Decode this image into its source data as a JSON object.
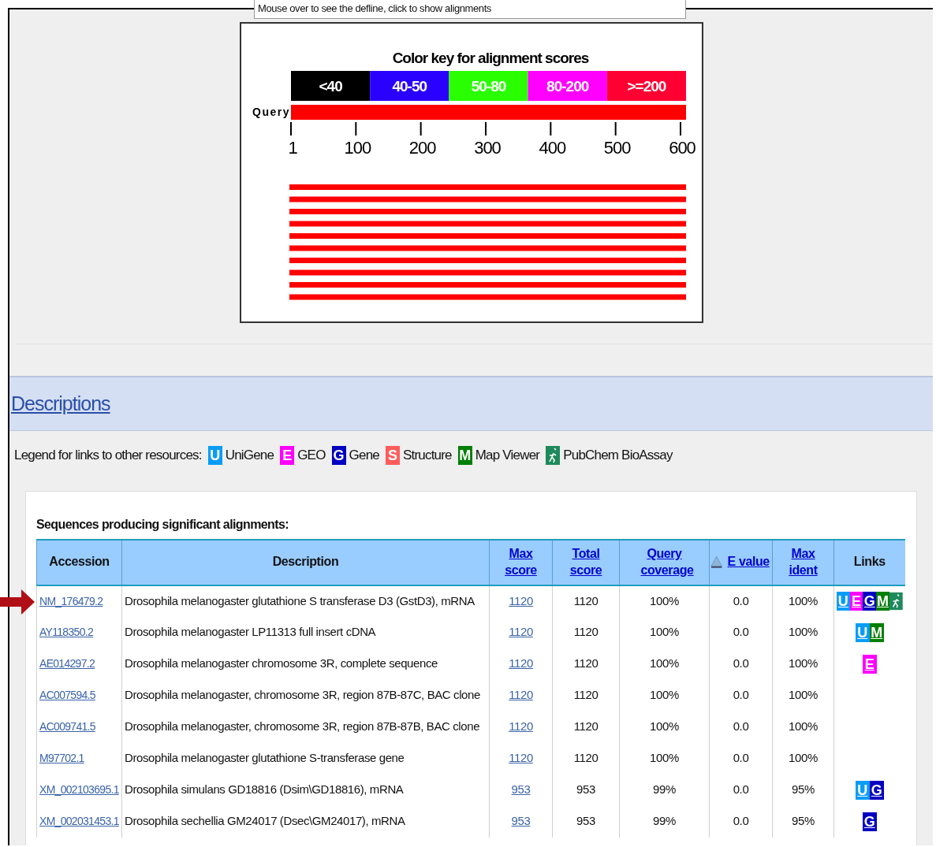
{
  "caption": "Mouse over to see the defline, click to show alignments",
  "graphic": {
    "title": "Color key for alignment scores",
    "query_label": "Query",
    "key": [
      {
        "label": "<40",
        "color": "#000000"
      },
      {
        "label": "40-50",
        "color": "#2a00ff"
      },
      {
        "label": "50-80",
        "color": "#29ff00"
      },
      {
        "label": "80-200",
        "color": "#ff00ff"
      },
      {
        "label": ">=200",
        "color": "#ff0033"
      }
    ],
    "ticks": [
      "1",
      "100",
      "200",
      "300",
      "400",
      "500",
      "600"
    ],
    "hits": [
      {
        "color": "#ff0000"
      },
      {
        "color": "#ff0000"
      },
      {
        "color": "#ff0000"
      },
      {
        "color": "#ff0000"
      },
      {
        "color": "#ff0000"
      },
      {
        "color": "#ff0000"
      },
      {
        "color": "#ff0000"
      },
      {
        "color": "#ff0000"
      },
      {
        "color": "#ff0000"
      },
      {
        "color": "#ff0000"
      }
    ]
  },
  "descriptions": {
    "heading": "Descriptions",
    "legend_intro": "Legend for links to other resources:",
    "legend": [
      {
        "kind": "letter",
        "letter": "U",
        "label": "UniGene",
        "color": "#0a9cf5"
      },
      {
        "kind": "letter",
        "letter": "E",
        "label": "GEO",
        "color": "#ff00ff"
      },
      {
        "kind": "letter",
        "letter": "G",
        "label": "Gene",
        "color": "#0000c0"
      },
      {
        "kind": "letter",
        "letter": "S",
        "label": "Structure",
        "color": "#ff5c5c"
      },
      {
        "kind": "letter",
        "letter": "M",
        "label": "Map Viewer",
        "color": "#007f00"
      },
      {
        "kind": "figure",
        "label": "PubChem BioAssay",
        "color": "#1e8a5c"
      }
    ]
  },
  "table": {
    "title": "Sequences producing significant alignments:",
    "columns": [
      {
        "label": "Accession",
        "link": false,
        "sorted": false
      },
      {
        "label": "Description",
        "link": false,
        "sorted": false
      },
      {
        "label": "Max score",
        "link": true,
        "sorted": false
      },
      {
        "label": "Total score",
        "link": true,
        "sorted": false
      },
      {
        "label": "Query coverage",
        "link": true,
        "sorted": false
      },
      {
        "label": "E value",
        "link": true,
        "sorted": true
      },
      {
        "label": "Max ident",
        "link": true,
        "sorted": false
      },
      {
        "label": "Links",
        "link": false,
        "sorted": false
      }
    ],
    "rows": [
      {
        "marked": true,
        "accession": "NM_176479.2",
        "description": "Drosophila melanogaster glutathione S transferase D3 (GstD3), mRNA",
        "max_score": "1120",
        "total_score": "1120",
        "query_coverage": "100%",
        "e_value": "0.0",
        "max_ident": "100%",
        "links": [
          {
            "kind": "letter",
            "letter": "U",
            "color": "#0a9cf5"
          },
          {
            "kind": "letter",
            "letter": "E",
            "color": "#ff00ff"
          },
          {
            "kind": "letter",
            "letter": "G",
            "color": "#0000c0"
          },
          {
            "kind": "letter",
            "letter": "M",
            "color": "#007f00"
          },
          {
            "kind": "figure",
            "color": "#1e8a5c"
          }
        ]
      },
      {
        "marked": false,
        "accession": "AY118350.2",
        "description": "Drosophila melanogaster LP11313 full insert cDNA",
        "max_score": "1120",
        "total_score": "1120",
        "query_coverage": "100%",
        "e_value": "0.0",
        "max_ident": "100%",
        "links": [
          {
            "kind": "letter",
            "letter": "U",
            "color": "#0a9cf5"
          },
          {
            "kind": "letter",
            "letter": "M",
            "color": "#007f00"
          }
        ]
      },
      {
        "marked": false,
        "accession": "AE014297.2",
        "description": "Drosophila melanogaster chromosome 3R, complete sequence",
        "max_score": "1120",
        "total_score": "1120",
        "query_coverage": "100%",
        "e_value": "0.0",
        "max_ident": "100%",
        "links": [
          {
            "kind": "letter",
            "letter": "E",
            "color": "#ff00ff"
          }
        ]
      },
      {
        "marked": false,
        "accession": "AC007594.5",
        "description": "Drosophila melanogaster, chromosome 3R, region 87B-87C, BAC clone",
        "max_score": "1120",
        "total_score": "1120",
        "query_coverage": "100%",
        "e_value": "0.0",
        "max_ident": "100%"
      },
      {
        "marked": false,
        "accession": "AC009741.5",
        "description": "Drosophila melanogaster, chromosome 3R, region 87B-87B, BAC clone",
        "max_score": "1120",
        "total_score": "1120",
        "query_coverage": "100%",
        "e_value": "0.0",
        "max_ident": "100%"
      },
      {
        "marked": false,
        "accession": "M97702.1",
        "description": "Drosophila melanogaster glutathione S-transferase gene",
        "max_score": "1120",
        "total_score": "1120",
        "query_coverage": "100%",
        "e_value": "0.0",
        "max_ident": "100%"
      },
      {
        "marked": false,
        "accession": "XM_002103695.1",
        "description": "Drosophila simulans GD18816 (Dsim\\GD18816), mRNA",
        "max_score": "953",
        "total_score": "953",
        "query_coverage": "99%",
        "e_value": "0.0",
        "max_ident": "95%",
        "links": [
          {
            "kind": "letter",
            "letter": "U",
            "color": "#0a9cf5"
          },
          {
            "kind": "letter",
            "letter": "G",
            "color": "#0000c0"
          }
        ]
      },
      {
        "marked": false,
        "accession": "XM_002031453.1",
        "description": "Drosophila sechellia GM24017 (Dsec\\GM24017), mRNA",
        "max_score": "953",
        "total_score": "953",
        "query_coverage": "99%",
        "e_value": "0.0",
        "max_ident": "95%",
        "links": [
          {
            "kind": "letter",
            "letter": "G",
            "color": "#0000c0"
          }
        ]
      }
    ]
  }
}
